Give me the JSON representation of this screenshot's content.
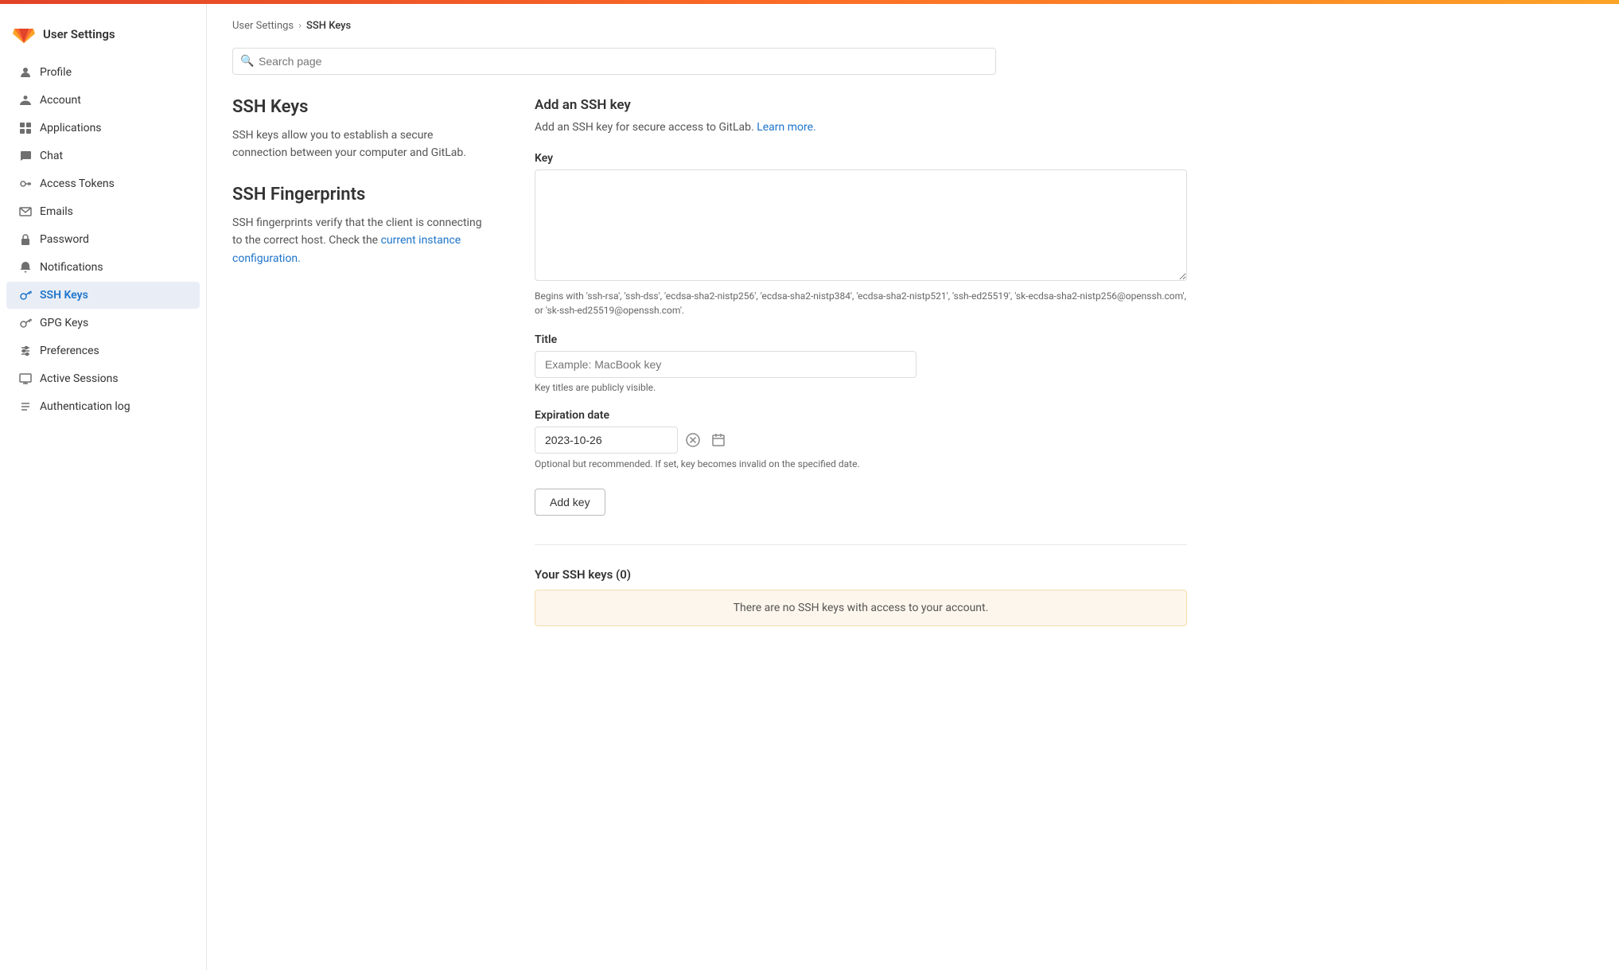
{
  "topBar": {},
  "sidebar": {
    "title": "User Settings",
    "logoAlt": "GitLab logo",
    "nav": [
      {
        "id": "profile",
        "label": "Profile",
        "icon": "person"
      },
      {
        "id": "account",
        "label": "Account",
        "icon": "person-badge"
      },
      {
        "id": "applications",
        "label": "Applications",
        "icon": "grid"
      },
      {
        "id": "chat",
        "label": "Chat",
        "icon": "chat"
      },
      {
        "id": "access-tokens",
        "label": "Access Tokens",
        "icon": "token"
      },
      {
        "id": "emails",
        "label": "Emails",
        "icon": "envelope"
      },
      {
        "id": "password",
        "label": "Password",
        "icon": "lock"
      },
      {
        "id": "notifications",
        "label": "Notifications",
        "icon": "bell"
      },
      {
        "id": "ssh-keys",
        "label": "SSH Keys",
        "icon": "key",
        "active": true
      },
      {
        "id": "gpg-keys",
        "label": "GPG Keys",
        "icon": "key2"
      },
      {
        "id": "preferences",
        "label": "Preferences",
        "icon": "sliders"
      },
      {
        "id": "active-sessions",
        "label": "Active Sessions",
        "icon": "monitor"
      },
      {
        "id": "auth-log",
        "label": "Authentication log",
        "icon": "list"
      }
    ]
  },
  "breadcrumb": {
    "parent": "User Settings",
    "current": "SSH Keys",
    "separator": "›"
  },
  "search": {
    "placeholder": "Search page"
  },
  "leftCol": {
    "sshKeysTitle": "SSH Keys",
    "sshKeysDesc": "SSH keys allow you to establish a secure connection between your computer and GitLab.",
    "sshFingerprintsTitle": "SSH Fingerprints",
    "sshFingerprintsDesc": "SSH fingerprints verify that the client is connecting to the correct host. Check the ",
    "sshFingerprintsLinkText": "current instance configuration.",
    "sshFingerprintsLinkHref": "#"
  },
  "rightCol": {
    "addTitle": "Add an SSH key",
    "addDesc": "Add an SSH key for secure access to GitLab. ",
    "addLinkText": "Learn more.",
    "addLinkHref": "#",
    "keyLabel": "Key",
    "keyHint": "Begins with 'ssh-rsa', 'ssh-dss', 'ecdsa-sha2-nistp256', 'ecdsa-sha2-nistp384', 'ecdsa-sha2-nistp521', 'ssh-ed25519', 'sk-ecdsa-sha2-nistp256@openssh.com', or 'sk-ssh-ed25519@openssh.com'.",
    "titleLabel": "Title",
    "titlePlaceholder": "Example: MacBook key",
    "titleHint": "Key titles are publicly visible.",
    "expirationLabel": "Expiration date",
    "expirationValue": "2023-10-26",
    "expirationHint": "Optional but recommended. If set, key becomes invalid on the specified date.",
    "addKeyButton": "Add key",
    "yourKeysTitle": "Your SSH keys (0)",
    "noKeysMessage": "There are no SSH keys with access to your account."
  }
}
